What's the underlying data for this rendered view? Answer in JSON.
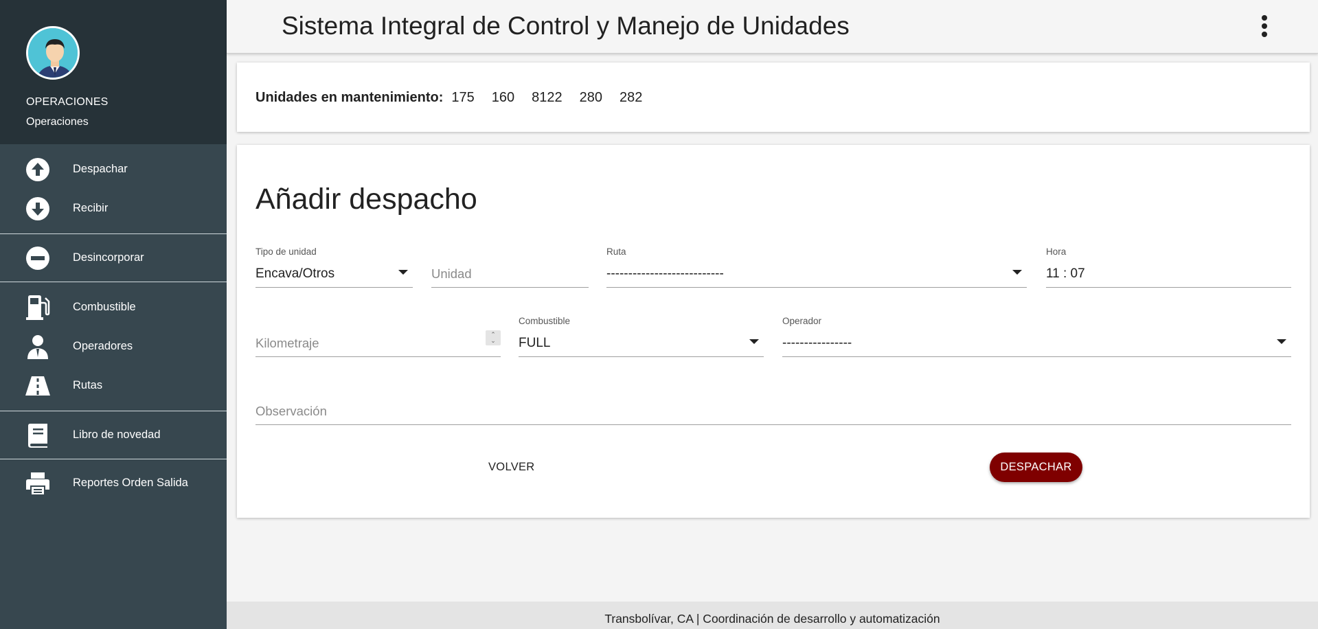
{
  "header": {
    "title": "Sistema Integral de Control y Manejo de Unidades"
  },
  "user": {
    "name": "OPERACIONES",
    "role": "Operaciones"
  },
  "sidebar": {
    "items": [
      {
        "label": "Despachar",
        "icon": "arrow-up-circle-icon"
      },
      {
        "label": "Recibir",
        "icon": "arrow-down-circle-icon"
      },
      {
        "label": "Desincorporar",
        "icon": "minus-circle-icon"
      },
      {
        "label": "Combustible",
        "icon": "gas-station-icon"
      },
      {
        "label": "Operadores",
        "icon": "person-tie-icon"
      },
      {
        "label": "Rutas",
        "icon": "road-icon"
      },
      {
        "label": "Libro de novedad",
        "icon": "book-icon"
      },
      {
        "label": "Reportes Orden Salida",
        "icon": "printer-icon"
      }
    ]
  },
  "maintenance": {
    "label": "Unidades en mantenimiento:",
    "units": [
      "175",
      "160",
      "8122",
      "280",
      "282"
    ]
  },
  "form": {
    "title": "Añadir despacho",
    "tipo_unidad": {
      "label": "Tipo de unidad",
      "value": "Encava/Otros"
    },
    "unidad": {
      "placeholder": "Unidad"
    },
    "ruta": {
      "label": "Ruta",
      "value": "---------------------------"
    },
    "hora": {
      "label": "Hora",
      "value": "11 : 07"
    },
    "kilometraje": {
      "placeholder": "Kilometraje"
    },
    "combustible": {
      "label": "Combustible",
      "value": "FULL"
    },
    "operador": {
      "label": "Operador",
      "value": "----------------"
    },
    "observacion": {
      "placeholder": "Observación"
    },
    "volver_label": "VOLVER",
    "despachar_label": "DESPACHAR"
  },
  "footer": {
    "text": "Transbolívar, CA | Coordinación de desarrollo y automatización"
  },
  "colors": {
    "sidebar_bg": "#37474f",
    "sidebar_header_bg": "#263238",
    "primary_button": "#7f0000",
    "avatar_bg": "#4fc3d6"
  }
}
